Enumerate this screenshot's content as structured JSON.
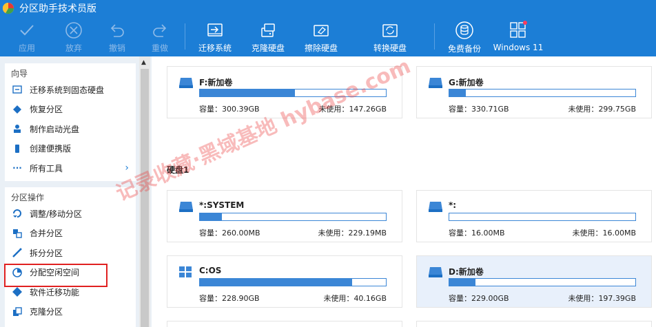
{
  "app": {
    "title": "分区助手技术员版"
  },
  "toolbar": {
    "apply": "应用",
    "discard": "放弃",
    "undo": "撤销",
    "redo": "重做",
    "migrate": "迁移系统",
    "clone": "克隆硬盘",
    "wipe": "擦除硬盘",
    "convert": "转换硬盘",
    "backup": "免费备份",
    "win11": "Windows 11"
  },
  "sidebar": {
    "guide_title": "向导",
    "guide_items": [
      "迁移系统到固态硬盘",
      "恢复分区",
      "制作启动光盘",
      "创建便携版",
      "所有工具"
    ],
    "ops_title": "分区操作",
    "ops_items": [
      "调整/移动分区",
      "合并分区",
      "拆分分区",
      "分配空闲空间",
      "软件迁移功能",
      "克隆分区"
    ]
  },
  "labels": {
    "capacity": "容量：",
    "unused": "未使用："
  },
  "disk1_header": "硬盘1",
  "partitions": [
    {
      "name": "F:新加卷",
      "capacity": "300.39GB",
      "unused": "147.26GB",
      "used_fraction": 0.51
    },
    {
      "name": "G:新加卷",
      "capacity": "330.71GB",
      "unused": "299.75GB",
      "used_fraction": 0.09
    },
    {
      "name": "*:SYSTEM",
      "capacity": "260.00MB",
      "unused": "229.19MB",
      "used_fraction": 0.12
    },
    {
      "name": "*:",
      "capacity": "16.00MB",
      "unused": "16.00MB",
      "used_fraction": 0.0
    },
    {
      "name": "C:OS",
      "capacity": "228.90GB",
      "unused": "40.16GB",
      "used_fraction": 0.82
    },
    {
      "name": "D:新加卷",
      "capacity": "229.00GB",
      "unused": "197.39GB",
      "used_fraction": 0.14
    }
  ],
  "watermark": "记录收藏·黑域基地 hybase.com",
  "colors": {
    "brand": "#1c7ed6",
    "bar": "#3b86d6",
    "highlight": "#e02020"
  }
}
